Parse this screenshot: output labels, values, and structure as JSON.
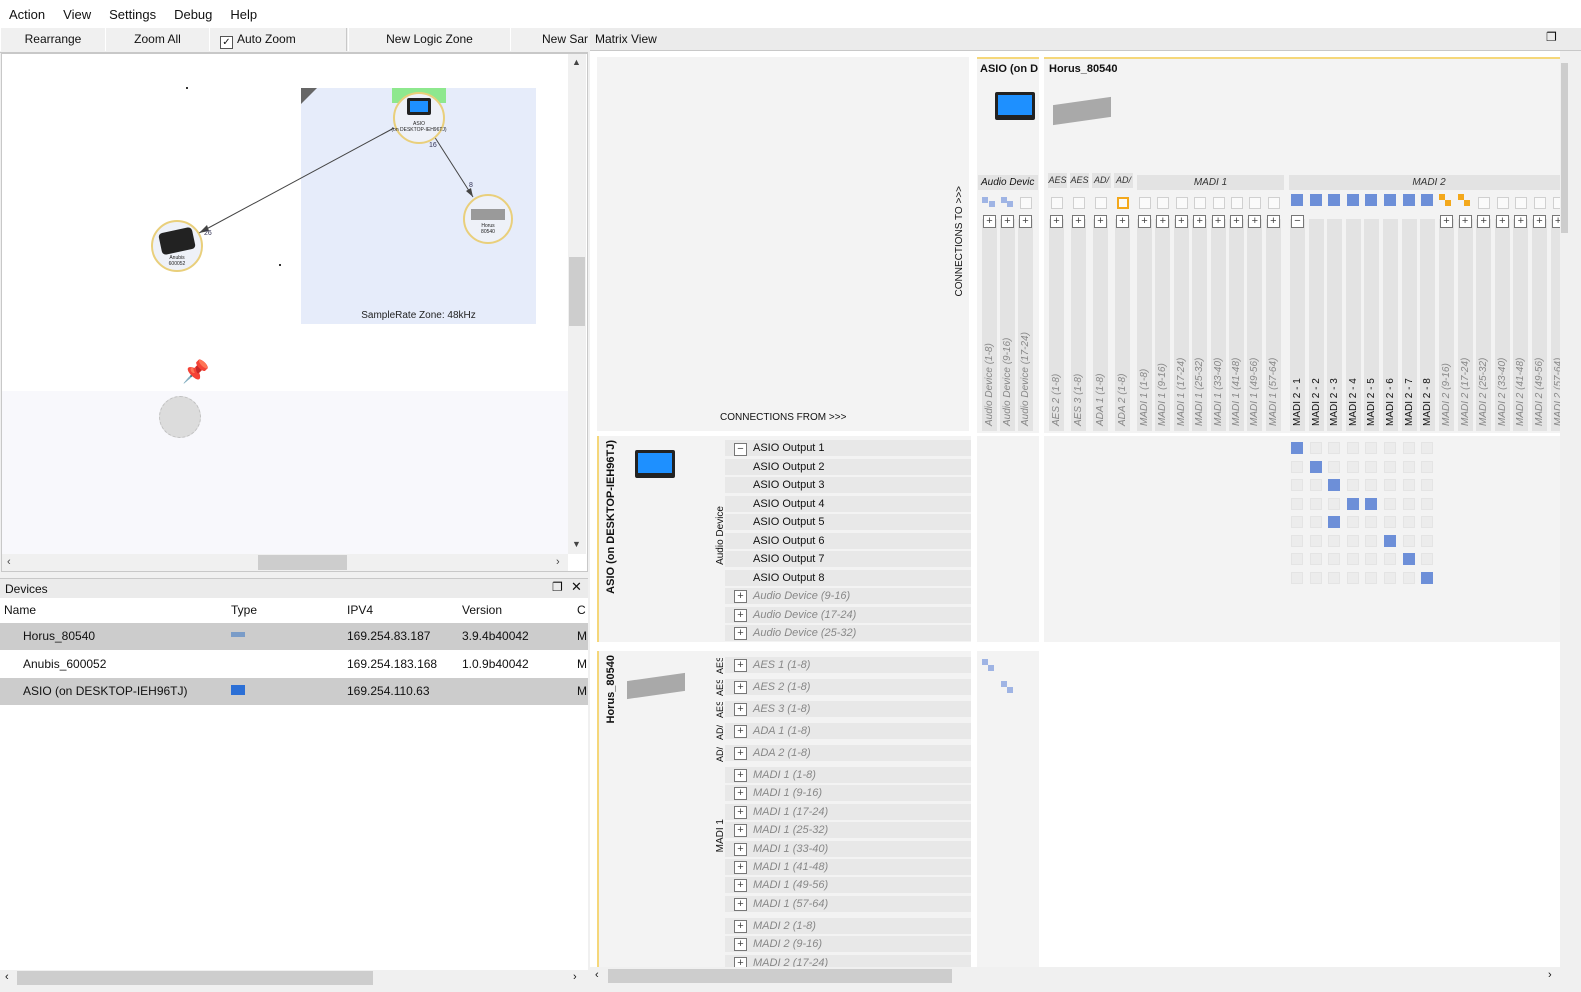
{
  "menu": {
    "items": [
      "Action",
      "View",
      "Settings",
      "Debug",
      "Help"
    ]
  },
  "toolbar": {
    "rearrange": "Rearrange",
    "zoom_all": "Zoom All",
    "auto_zoom": "Auto Zoom",
    "auto_zoom_checked": true,
    "new_logic_zone": "New Logic Zone",
    "new_sample": "New San"
  },
  "canvas": {
    "zone_label": "SampleRate Zone: 48kHz",
    "asio_label": "ASIO\n(on DESKTOP-IEH96TJ)",
    "horus_label": "Horus\n80540",
    "anubis_label": "Anubis\n600052",
    "edge_asio_anubis": "26",
    "edge_asio_horus_a": "16",
    "edge_asio_horus_b": "8"
  },
  "devices": {
    "title": "Devices",
    "columns": [
      "Name",
      "Type",
      "IPV4",
      "Version",
      "C"
    ],
    "rows": [
      {
        "name": "Horus_80540",
        "ipv4": "169.254.83.187",
        "version": "3.9.4b40042",
        "c": "M"
      },
      {
        "name": "Anubis_600052",
        "ipv4": "169.254.183.168",
        "version": "1.0.9b40042",
        "c": "M"
      },
      {
        "name": "ASIO (on DESKTOP-IEH96TJ)",
        "ipv4": "169.254.110.63",
        "version": "",
        "c": "M"
      }
    ]
  },
  "matrix": {
    "title": "Matrix View",
    "connections_to": "CONNECTIONS TO >>>",
    "connections_from": "CONNECTIONS FROM >>>",
    "dest_asio": "ASIO (on D",
    "dest_horus": "Horus_80540",
    "asio_group": "Audio Devic",
    "asio_cols": [
      "Audio Device (1-8)",
      "Audio Device (9-16)",
      "Audio Device (17-24)"
    ],
    "horus_small_groups": [
      "AES",
      "AES",
      "AD/",
      "AD/"
    ],
    "madi1_group": "MADI 1",
    "madi2_group": "MADI 2",
    "horus_cols": [
      "AES 2 (1-8)",
      "AES 3 (1-8)",
      "ADA 1 (1-8)",
      "ADA 2 (1-8)",
      "MADI 1 (1-8)",
      "MADI 1 (9-16)",
      "MADI 1 (17-24)",
      "MADI 1 (25-32)",
      "MADI 1 (33-40)",
      "MADI 1 (41-48)",
      "MADI 1 (49-56)",
      "MADI 1 (57-64)"
    ],
    "madi2_cols": [
      "MADI 2 - 1",
      "MADI 2 - 2",
      "MADI 2 - 3",
      "MADI 2 - 4",
      "MADI 2 - 5",
      "MADI 2 - 6",
      "MADI 2 - 7",
      "MADI 2 - 8"
    ],
    "madi2_rest": [
      "MADI 2 (9-16)",
      "MADI 2 (17-24)",
      "MADI 2 (25-32)",
      "MADI 2 (33-40)",
      "MADI 2 (41-48)",
      "MADI 2 (49-56)",
      "MADI 2 (57-64)"
    ],
    "src_asio": "ASIO (on DESKTOP-IEH96TJ)",
    "src_asio_group": "Audio Device",
    "asio_rows": [
      "ASIO Output 1",
      "ASIO Output 2",
      "ASIO Output 3",
      "ASIO Output 4",
      "ASIO Output 5",
      "ASIO Output 6",
      "ASIO Output 7",
      "ASIO Output 8"
    ],
    "asio_rows_collapsed": [
      "Audio Device (9-16)",
      "Audio Device (17-24)",
      "Audio Device (25-32)"
    ],
    "src_horus": "Horus_80540",
    "horus_rows": [
      "AES 1 (1-8)",
      "AES 2 (1-8)",
      "AES 3 (1-8)",
      "ADA 1 (1-8)",
      "ADA 2 (1-8)"
    ],
    "horus_row_tags": [
      "AES",
      "AES",
      "AES",
      "AD/",
      "AD/"
    ],
    "madi1_rows": [
      "MADI 1 (1-8)",
      "MADI 1 (9-16)",
      "MADI 1 (17-24)",
      "MADI 1 (25-32)",
      "MADI 1 (33-40)",
      "MADI 1 (41-48)",
      "MADI 1 (49-56)",
      "MADI 1 (57-64)"
    ],
    "madi1_side": "MADI 1",
    "madi2_rows": [
      "MADI 2 (1-8)",
      "MADI 2 (9-16)",
      "MADI 2 (17-24)"
    ],
    "routing": [
      [
        1,
        1
      ],
      [
        2,
        2
      ],
      [
        3,
        3
      ],
      [
        4,
        4
      ],
      [
        4,
        5
      ],
      [
        5,
        3
      ],
      [
        6,
        6
      ],
      [
        7,
        7
      ],
      [
        8,
        8
      ]
    ]
  },
  "colors": {
    "accent_blue": "#6d8fd8",
    "orange": "#f3a81c",
    "zone_bg": "#e6ecfa",
    "node_border": "#e9cf7b",
    "selection": "#cccccc"
  }
}
